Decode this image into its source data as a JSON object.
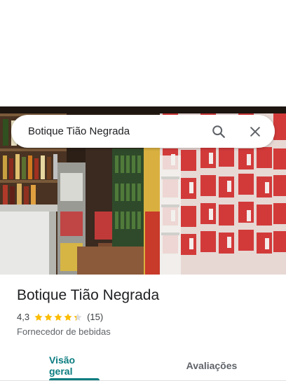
{
  "search": {
    "query": "Botique Tião Negrada"
  },
  "place": {
    "name": "Botique Tião Negrada",
    "rating": "4,3",
    "rating_value": 4.3,
    "stars_max": 5,
    "review_count": "(15)",
    "category": "Fornecedor de bebidas"
  },
  "tabs": [
    {
      "label": "Visão geral",
      "active": true
    },
    {
      "label": "Avaliações",
      "active": false
    }
  ],
  "colors": {
    "accent": "#0b7c80",
    "star": "#fbbc04",
    "star_empty": "#dadce0"
  },
  "icons": {
    "search": "search-icon",
    "close": "close-icon",
    "star": "star-icon"
  }
}
